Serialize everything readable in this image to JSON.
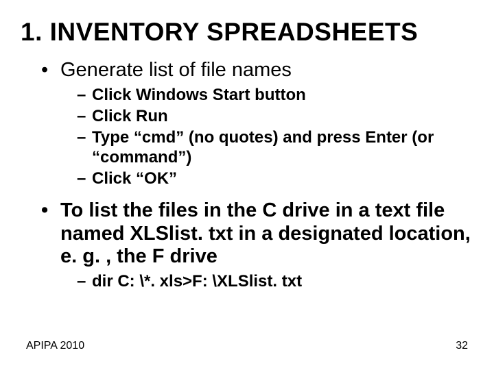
{
  "title": "1. INVENTORY SPREADSHEETS",
  "bullets": {
    "item1": "Generate list of file names",
    "sub1a": "Click Windows Start button",
    "sub1b": "Click Run",
    "sub1c": "Type “cmd” (no quotes) and press Enter (or “command”)",
    "sub1d": "Click “OK”",
    "item2": "To list the files in the C drive in a text file named XLSlist. txt in a designated location, e. g. , the F drive",
    "sub2a": "dir C: \\*. xls>F: \\XLSlist. txt"
  },
  "footer": {
    "left": "APIPA 2010",
    "right": "32"
  }
}
